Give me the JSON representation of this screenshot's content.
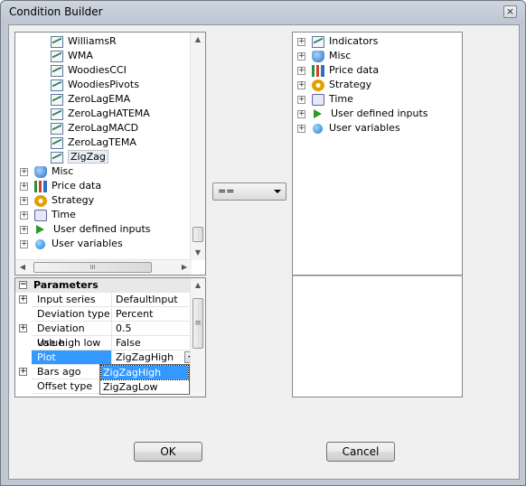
{
  "window": {
    "title": "Condition Builder",
    "close_symbol": "×"
  },
  "left_tree": {
    "indicators": [
      "WilliamsR",
      "WMA",
      "WoodiesCCI",
      "WoodiesPivots",
      "ZeroLagEMA",
      "ZeroLagHATEMA",
      "ZeroLagMACD",
      "ZeroLagTEMA",
      "ZigZag"
    ],
    "categories": [
      {
        "label": "Misc",
        "icon": "misc-icon"
      },
      {
        "label": "Price data",
        "icon": "price-data-icon"
      },
      {
        "label": "Strategy",
        "icon": "strategy-icon"
      },
      {
        "label": "Time",
        "icon": "time-icon"
      },
      {
        "label": "User defined inputs",
        "icon": "user-defined-inputs-icon"
      },
      {
        "label": "User variables",
        "icon": "user-variables-icon"
      }
    ],
    "selected": "ZigZag"
  },
  "right_tree": {
    "items": [
      {
        "label": "Indicators",
        "icon": "indicators-icon"
      },
      {
        "label": "Misc",
        "icon": "misc-icon"
      },
      {
        "label": "Price data",
        "icon": "price-data-icon"
      },
      {
        "label": "Strategy",
        "icon": "strategy-icon"
      },
      {
        "label": "Time",
        "icon": "time-icon"
      },
      {
        "label": "User defined inputs",
        "icon": "user-defined-inputs-icon"
      },
      {
        "label": "User variables",
        "icon": "user-variables-icon"
      }
    ]
  },
  "operator": {
    "value": "=="
  },
  "parameters": {
    "header": "Parameters",
    "rows": [
      {
        "name": "Input series",
        "value": "DefaultInput",
        "expandable": true
      },
      {
        "name": "Deviation type",
        "value": "Percent",
        "expandable": false
      },
      {
        "name": "Deviation value",
        "value": "0.5",
        "expandable": true
      },
      {
        "name": "Use high low",
        "value": "False",
        "expandable": false
      },
      {
        "name": "Plot",
        "value": "ZigZagHigh",
        "expandable": false,
        "selected": true
      },
      {
        "name": "Bars ago",
        "value": "",
        "expandable": true
      },
      {
        "name": "Offset type",
        "value": "",
        "expandable": false
      }
    ],
    "dropdown_options": [
      "ZigZagHigh",
      "ZigZagLow"
    ],
    "dropdown_highlighted": "ZigZagHigh"
  },
  "buttons": {
    "ok": "OK",
    "cancel": "Cancel"
  },
  "scroll_symbols": {
    "up": "▲",
    "down": "▼",
    "left": "◀",
    "right": "▶",
    "thumb_grip": "III",
    "grip": "≡"
  },
  "expand_symbol": "+",
  "colors": {
    "selection": "#3399ff",
    "plot_row": "#3399ff"
  }
}
